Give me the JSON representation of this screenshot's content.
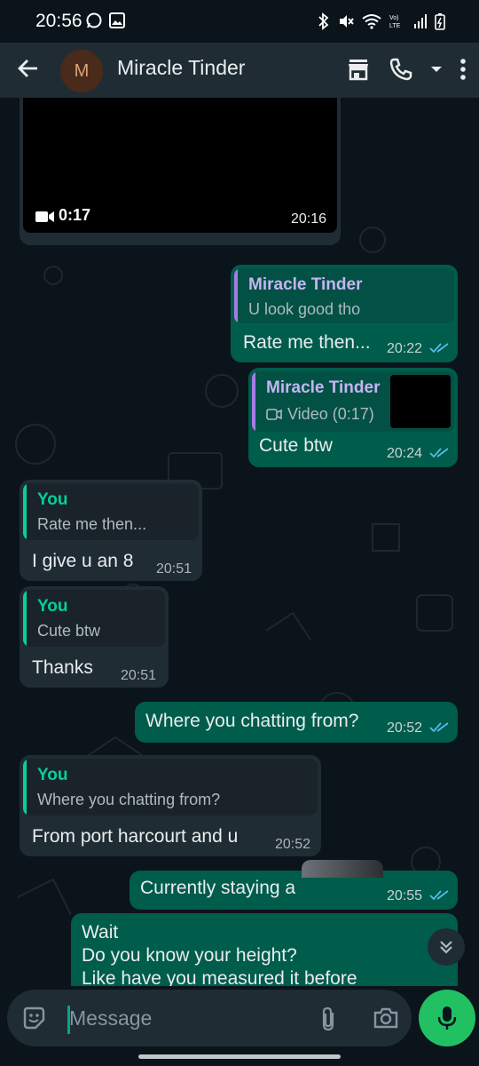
{
  "status_bar": {
    "time": "20:56"
  },
  "header": {
    "avatar_letter": "M",
    "contact_name": "Miracle Tinder"
  },
  "messages": {
    "video": {
      "duration": "0:17",
      "time": "20:16"
    },
    "m1": {
      "quote_name": "Miracle Tinder",
      "quote_text": "U look good tho",
      "text": "Rate me then...",
      "time": "20:22"
    },
    "m2": {
      "quote_name": "Miracle Tinder",
      "quote_text": "Video (0:17)",
      "text": "Cute btw",
      "time": "20:24"
    },
    "m3": {
      "quote_name": "You",
      "quote_text": "Rate me then...",
      "text": "I give u an 8",
      "time": "20:51"
    },
    "m4": {
      "quote_name": "You",
      "quote_text": "Cute btw",
      "text": "Thanks",
      "time": "20:51"
    },
    "m5": {
      "text": "Where you chatting from?",
      "time": "20:52"
    },
    "m6": {
      "quote_name": "You",
      "quote_text": "Where you chatting from?",
      "text": "From port harcourt and u",
      "time": "20:52"
    },
    "m7": {
      "text": "Currently staying a",
      "time": "20:55"
    },
    "m8": {
      "lines": [
        "Wait",
        "Do you know your height?",
        "Like have you measured it before"
      ]
    }
  },
  "input": {
    "placeholder": "Message"
  },
  "colors": {
    "accent": "#00a884",
    "out_bubble": "#005c4b",
    "in_bubble": "#202c33",
    "quote_purple": "#a67be7",
    "quote_green": "#06cf9c",
    "tick_blue": "#53bdeb"
  }
}
